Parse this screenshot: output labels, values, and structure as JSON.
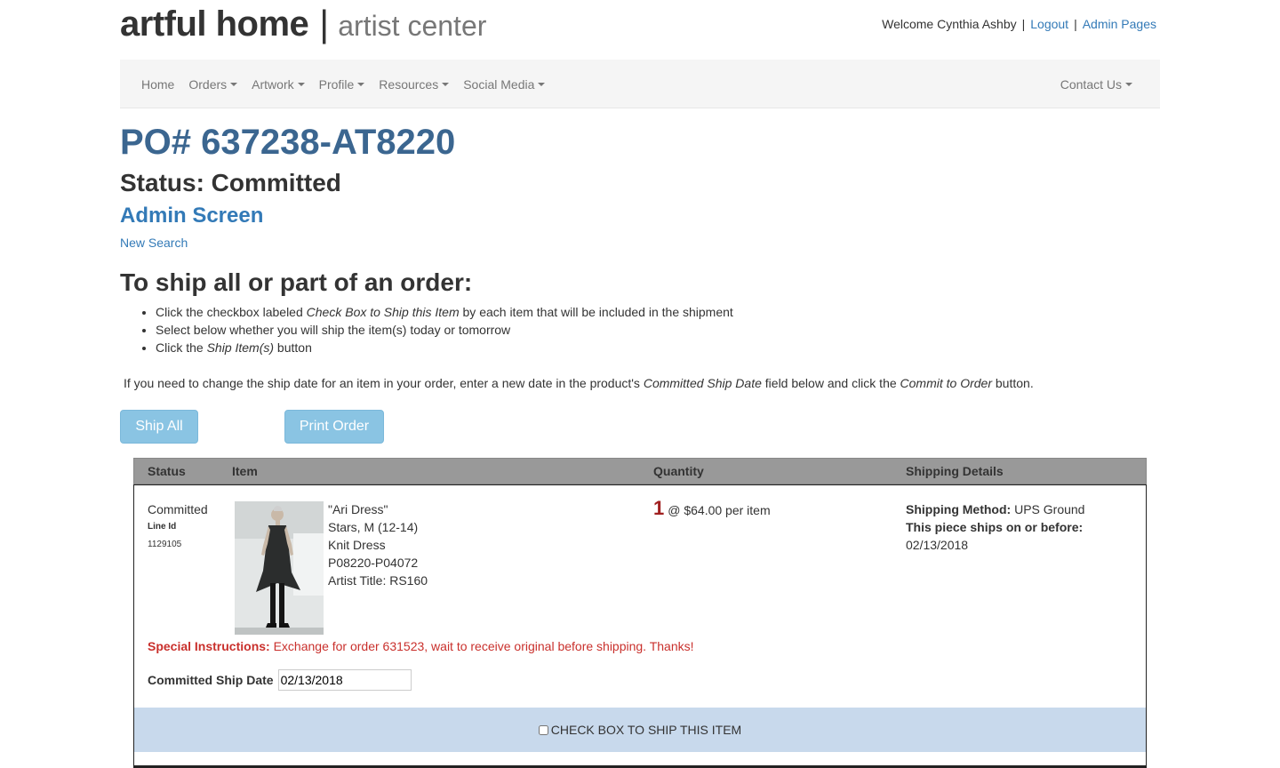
{
  "brand": {
    "main": "artful home",
    "separator": "|",
    "sub": "artist center"
  },
  "user": {
    "welcome": "Welcome Cynthia Ashby",
    "logout": "Logout",
    "admin_pages": "Admin Pages"
  },
  "nav": {
    "home": "Home",
    "orders": "Orders",
    "artwork": "Artwork",
    "profile": "Profile",
    "resources": "Resources",
    "social_media": "Social Media",
    "contact_us": "Contact Us"
  },
  "order": {
    "po": "PO# 637238-AT8220",
    "status": "Status: Committed",
    "admin_screen": "Admin Screen",
    "new_search": "New Search"
  },
  "instructions": {
    "title": "To ship all or part of an order:",
    "step1_pre": "Click the checkbox labeled ",
    "step1_em": "Check Box to Ship this Item",
    "step1_post": " by each item that will be included in the shipment",
    "step2": "Select below whether you will ship the item(s) today or tomorrow",
    "step3_pre": "Click the ",
    "step3_em": "Ship Item(s)",
    "step3_post": " button",
    "note_pre": "If you need to change the ship date for an item in your order, enter a new date in the product's ",
    "note_em1": "Committed Ship Date",
    "note_mid": " field below and click the ",
    "note_em2": "Commit to Order",
    "note_post": " button."
  },
  "buttons": {
    "ship_all": "Ship All",
    "print_order": "Print Order"
  },
  "table": {
    "headers": {
      "status": "Status",
      "item": "Item",
      "quantity": "Quantity",
      "shipping": "Shipping Details"
    },
    "row": {
      "status": "Committed",
      "line_id_label": "Line Id",
      "line_id": "1129105",
      "item_lines": [
        "\"Ari Dress\"",
        "Stars, M (12-14)",
        "Knit Dress",
        "P08220-P04072",
        "Artist Title: RS160"
      ],
      "qty": "1",
      "price": "@ $64.00 per item",
      "ship_method_label": "Shipping Method:",
      "ship_method": " UPS Ground",
      "ships_by_label": "This piece ships on or before:",
      "ships_by": "02/13/2018",
      "special_label": "Special Instructions:",
      "special_text": " Exchange for order 631523, wait to receive original before shipping. Thanks!",
      "committed_label": "Committed Ship Date",
      "committed_value": "02/13/2018",
      "ship_checkbox_label": "CHECK BOX TO SHIP THIS ITEM"
    }
  }
}
